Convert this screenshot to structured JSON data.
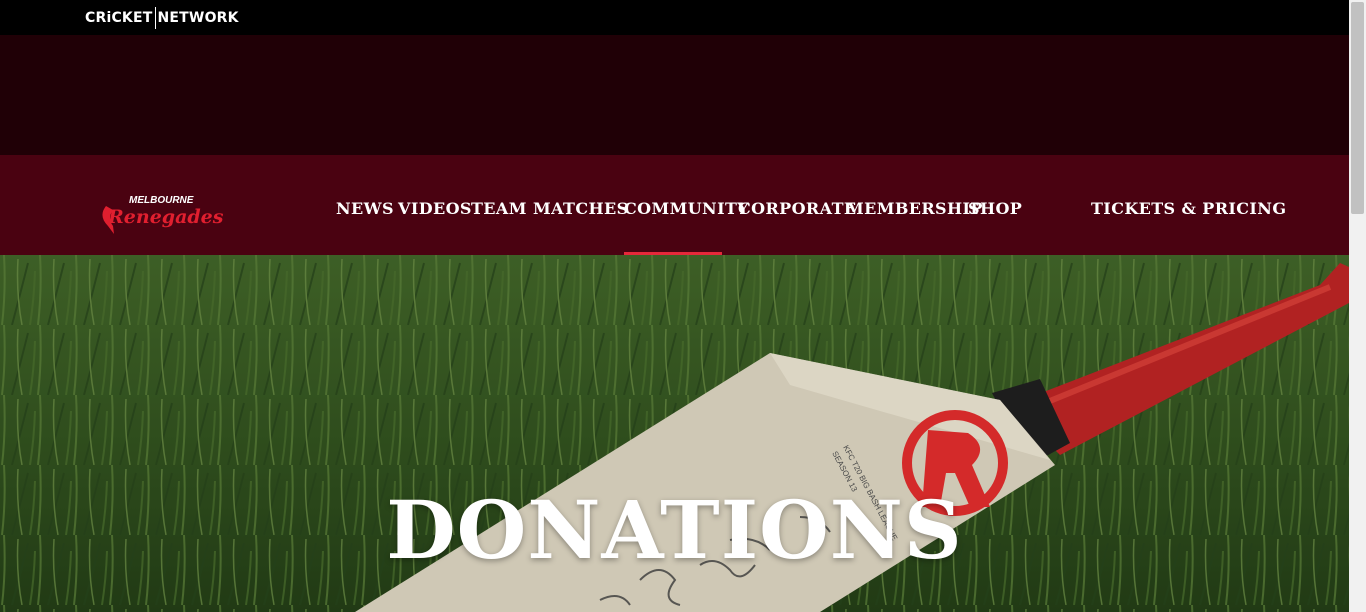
{
  "brand": {
    "network_left": "CRiCKET",
    "network_right": "NETWORK",
    "club_top": "MELBOURNE",
    "club_main": "Renegades"
  },
  "nav": {
    "items": [
      {
        "label": "NEWS"
      },
      {
        "label": "VIDEOS"
      },
      {
        "label": "TEAM"
      },
      {
        "label": "MATCHES"
      },
      {
        "label": "COMMUNITY",
        "active": true
      },
      {
        "label": "CORPORATE"
      },
      {
        "label": "MEMBERSHIP"
      },
      {
        "label": "SHOP"
      }
    ],
    "tickets_label": "TICKETS & PRICING"
  },
  "hero": {
    "title": "DONATIONS",
    "bat_text_1": "KFC T20 BIG BASH LEAGUE",
    "bat_text_2": "SEASON 13"
  },
  "colors": {
    "accent": "#e6283a",
    "nav_bg": "#4a0211",
    "top_bg": "#000000"
  }
}
